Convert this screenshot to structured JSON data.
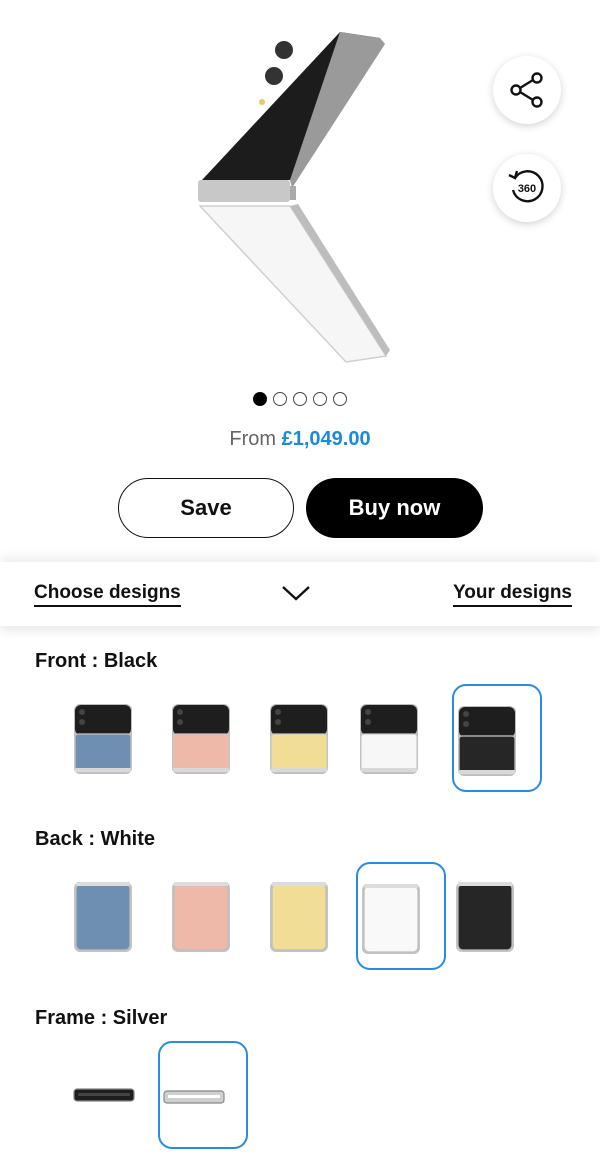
{
  "product": {
    "price_prefix": "From",
    "price_amount": "£1,049.00"
  },
  "gallery": {
    "slide_count": 5,
    "active_index": 0
  },
  "hero_actions": {
    "share_icon": "share-icon",
    "rotate_icon": "rotate-360-icon",
    "rotate_text": "360"
  },
  "actions": {
    "save_label": "Save",
    "buy_label": "Buy now"
  },
  "designs_bar": {
    "choose_label": "Choose designs",
    "your_label": "Your designs",
    "toggle_icon": "chevron-down-icon"
  },
  "front": {
    "label": "Front : Black",
    "options": [
      {
        "color": "#6f8fb2",
        "selected": false
      },
      {
        "color": "#eeb9a8",
        "selected": false
      },
      {
        "color": "#f1dd95",
        "selected": false
      },
      {
        "color": "#f7f7f7",
        "selected": false
      },
      {
        "color": "#262626",
        "selected": true
      }
    ]
  },
  "back": {
    "label": "Back : White",
    "options": [
      {
        "color": "#6f8fb2",
        "selected": false
      },
      {
        "color": "#eeb9a8",
        "selected": false
      },
      {
        "color": "#f1dd95",
        "selected": false
      },
      {
        "color": "#f9f9f9",
        "selected": true
      },
      {
        "color": "#262626",
        "selected": false
      }
    ]
  },
  "frame": {
    "label": "Frame : Silver",
    "options": [
      {
        "color": "#1e1e1e",
        "selected": false
      },
      {
        "color": "#cfcfcf",
        "selected": true
      }
    ]
  },
  "colors": {
    "accent_blue": "#1e8ad6",
    "selection_border": "#2a8be0"
  }
}
